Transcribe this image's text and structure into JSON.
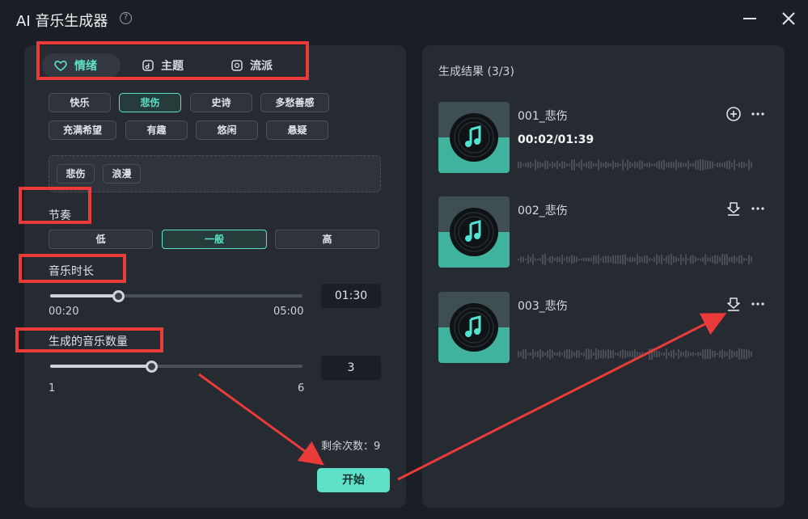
{
  "window": {
    "title": "AI 音乐生成器"
  },
  "tabs": [
    {
      "label": "情绪",
      "icon": "heart-icon",
      "active": true
    },
    {
      "label": "主题",
      "icon": "note-icon",
      "active": false
    },
    {
      "label": "流派",
      "icon": "cube-icon",
      "active": false
    }
  ],
  "moods": [
    {
      "label": "快乐",
      "selected": false
    },
    {
      "label": "悲伤",
      "selected": true
    },
    {
      "label": "史诗",
      "selected": false
    },
    {
      "label": "多愁善感",
      "selected": false
    },
    {
      "label": "充满希望",
      "selected": false
    },
    {
      "label": "有趣",
      "selected": false
    },
    {
      "label": "悠闲",
      "selected": false
    },
    {
      "label": "悬疑",
      "selected": false
    }
  ],
  "selected_tags": [
    "悲伤",
    "浪漫"
  ],
  "tempo": {
    "label": "节奏",
    "options": [
      "低",
      "一般",
      "高"
    ],
    "selected": "一般"
  },
  "duration": {
    "label": "音乐时长",
    "min": "00:20",
    "max": "05:00",
    "value": "01:30",
    "fraction": 0.27
  },
  "count": {
    "label": "生成的音乐数量",
    "min": "1",
    "max": "6",
    "value": "3",
    "fraction": 0.4
  },
  "remaining": "剩余次数：9",
  "start_label": "开始",
  "results": {
    "title": "生成结果 (3/3)",
    "tracks": [
      {
        "name": "001_悲伤",
        "time": "00:02/01:39",
        "action_icon": "add-circle-icon"
      },
      {
        "name": "002_悲伤",
        "time": "",
        "action_icon": "download-icon"
      },
      {
        "name": "003_悲伤",
        "time": "",
        "action_icon": "download-icon"
      }
    ]
  },
  "colors": {
    "accent": "#5fe0c8",
    "annotation": "#ea3b3b",
    "panel": "#262a31",
    "background": "#1b1e24"
  }
}
